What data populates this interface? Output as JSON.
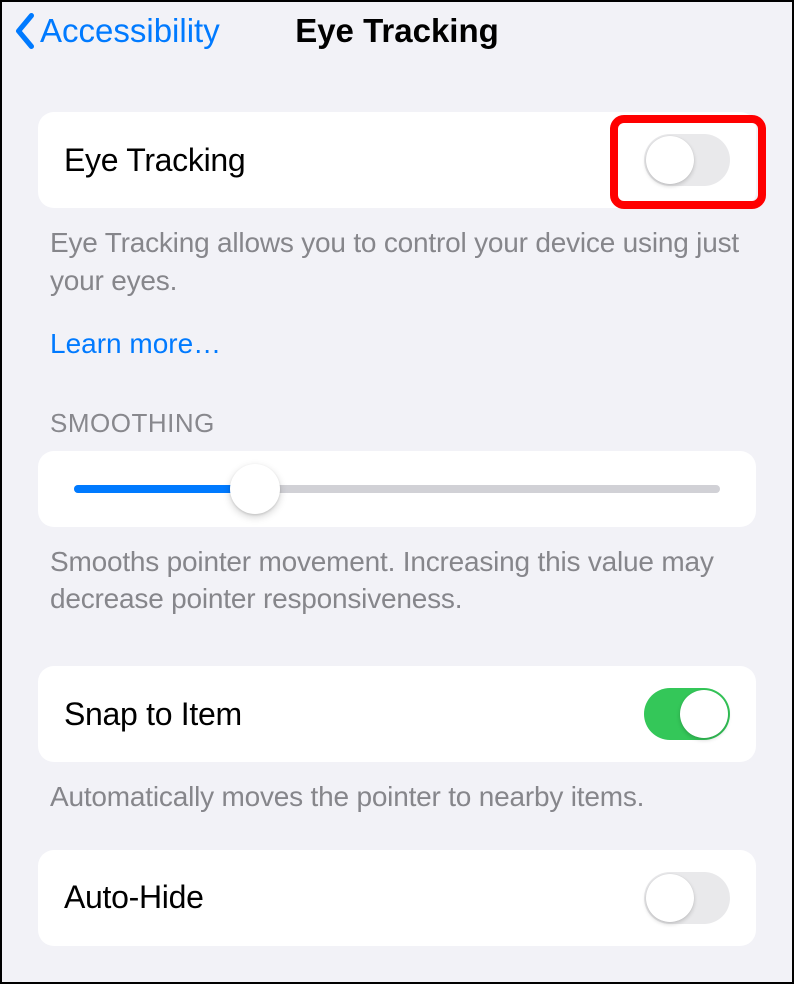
{
  "nav": {
    "back_label": "Accessibility",
    "title": "Eye Tracking"
  },
  "eye_tracking": {
    "label": "Eye Tracking",
    "enabled": false,
    "description": "Eye Tracking allows you to control your device using just your eyes.",
    "learn_more": "Learn more…"
  },
  "smoothing": {
    "header": "SMOOTHING",
    "value_percent": 28,
    "description": "Smooths pointer movement. Increasing this value may decrease pointer responsiveness."
  },
  "snap_to_item": {
    "label": "Snap to Item",
    "enabled": true,
    "description": "Automatically moves the pointer to nearby items."
  },
  "auto_hide": {
    "label": "Auto-Hide",
    "enabled": false
  }
}
